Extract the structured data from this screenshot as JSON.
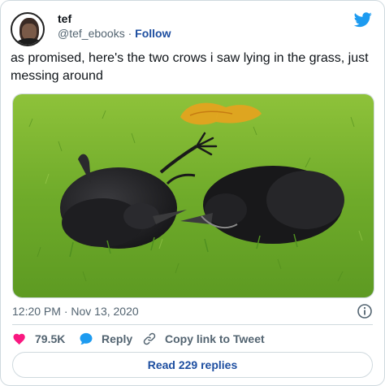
{
  "author": {
    "display_name": "tef",
    "handle": "@tef_ebooks",
    "separator": "·",
    "follow_label": "Follow"
  },
  "tweet": {
    "text": "as promised, here's the two crows i saw lying in the grass, just messing around",
    "timestamp": "12:20 PM · Nov 13, 2020"
  },
  "stats": {
    "likes": "79.5K",
    "reply_label": "Reply",
    "copy_link_label": "Copy link to Tweet"
  },
  "footer": {
    "read_replies_label": "Read 229 replies"
  },
  "colors": {
    "twitter_blue": "#1d9bf0",
    "link_blue": "#1d4ea0",
    "like_pink": "#f91880",
    "muted_gray": "#536471",
    "border": "#cfd9de"
  },
  "icons": {
    "brand": "twitter-bird-icon",
    "info": "info-icon",
    "like": "heart-icon",
    "reply": "speech-bubble-icon",
    "copy": "link-icon"
  }
}
